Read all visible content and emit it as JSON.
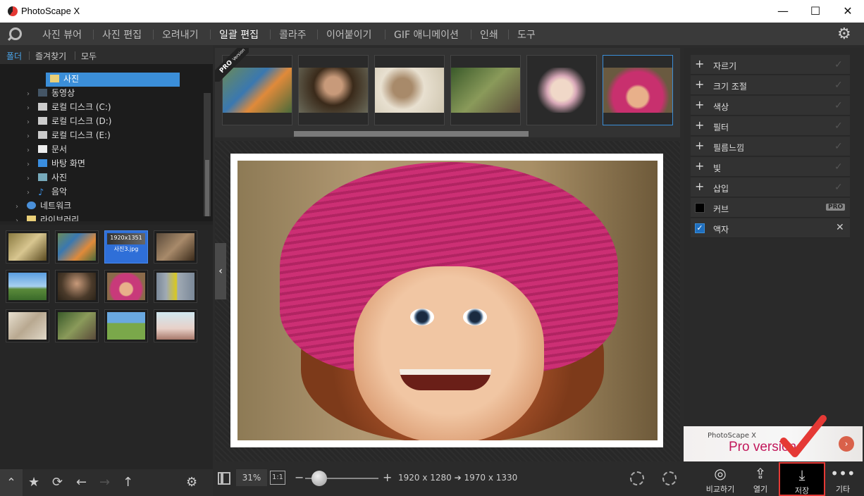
{
  "titlebar": {
    "title": "PhotoScape X",
    "minimize": "—",
    "maximize": "☐",
    "close": "✕"
  },
  "menu": {
    "items": [
      "사진 뷰어",
      "사진 편집",
      "오려내기",
      "일괄 편집",
      "콜라주",
      "이어붙이기",
      "GIF 애니메이션",
      "인쇄",
      "도구"
    ],
    "active": "일괄 편집"
  },
  "left": {
    "tabs": [
      "폴더",
      "즐겨찾기",
      "모두"
    ],
    "tree": [
      {
        "label": "사진",
        "selected": true
      },
      {
        "label": "동영상"
      },
      {
        "label": "로컬 디스크 (C:)"
      },
      {
        "label": "로컬 디스크 (D:)"
      },
      {
        "label": "로컬 디스크 (E:)"
      },
      {
        "label": "문서"
      },
      {
        "label": "바탕 화면"
      },
      {
        "label": "사진"
      },
      {
        "label": "음악"
      },
      {
        "label": "네트워크"
      },
      {
        "label": "라이브러리"
      }
    ],
    "selected_thumb": {
      "resolution": "1920x1351",
      "filename": "사진3.jpg"
    }
  },
  "filmstrip": {
    "pro_badge": "PRO",
    "pro_sub": "Version"
  },
  "bottom": {
    "zoom": "31%",
    "one_to_one": "1:1",
    "dimensions": "1920 x 1280 ➔ 1970 x 1330",
    "buttons": {
      "compare": "비교하기",
      "open": "열기",
      "save": "저장",
      "more": "기타"
    }
  },
  "right": {
    "items": [
      "자르기",
      "크기 조절",
      "색상",
      "필터",
      "필름느낌",
      "빛",
      "삽입"
    ],
    "curve": "커브",
    "curve_badge": "PRO",
    "frame": "액자"
  },
  "banner": {
    "line1": "PhotoScape X",
    "line2": "Pro version"
  },
  "colors": {
    "accent": "#3b8ed8",
    "highlight": "#e53935",
    "banner_text": "#c2185b"
  }
}
